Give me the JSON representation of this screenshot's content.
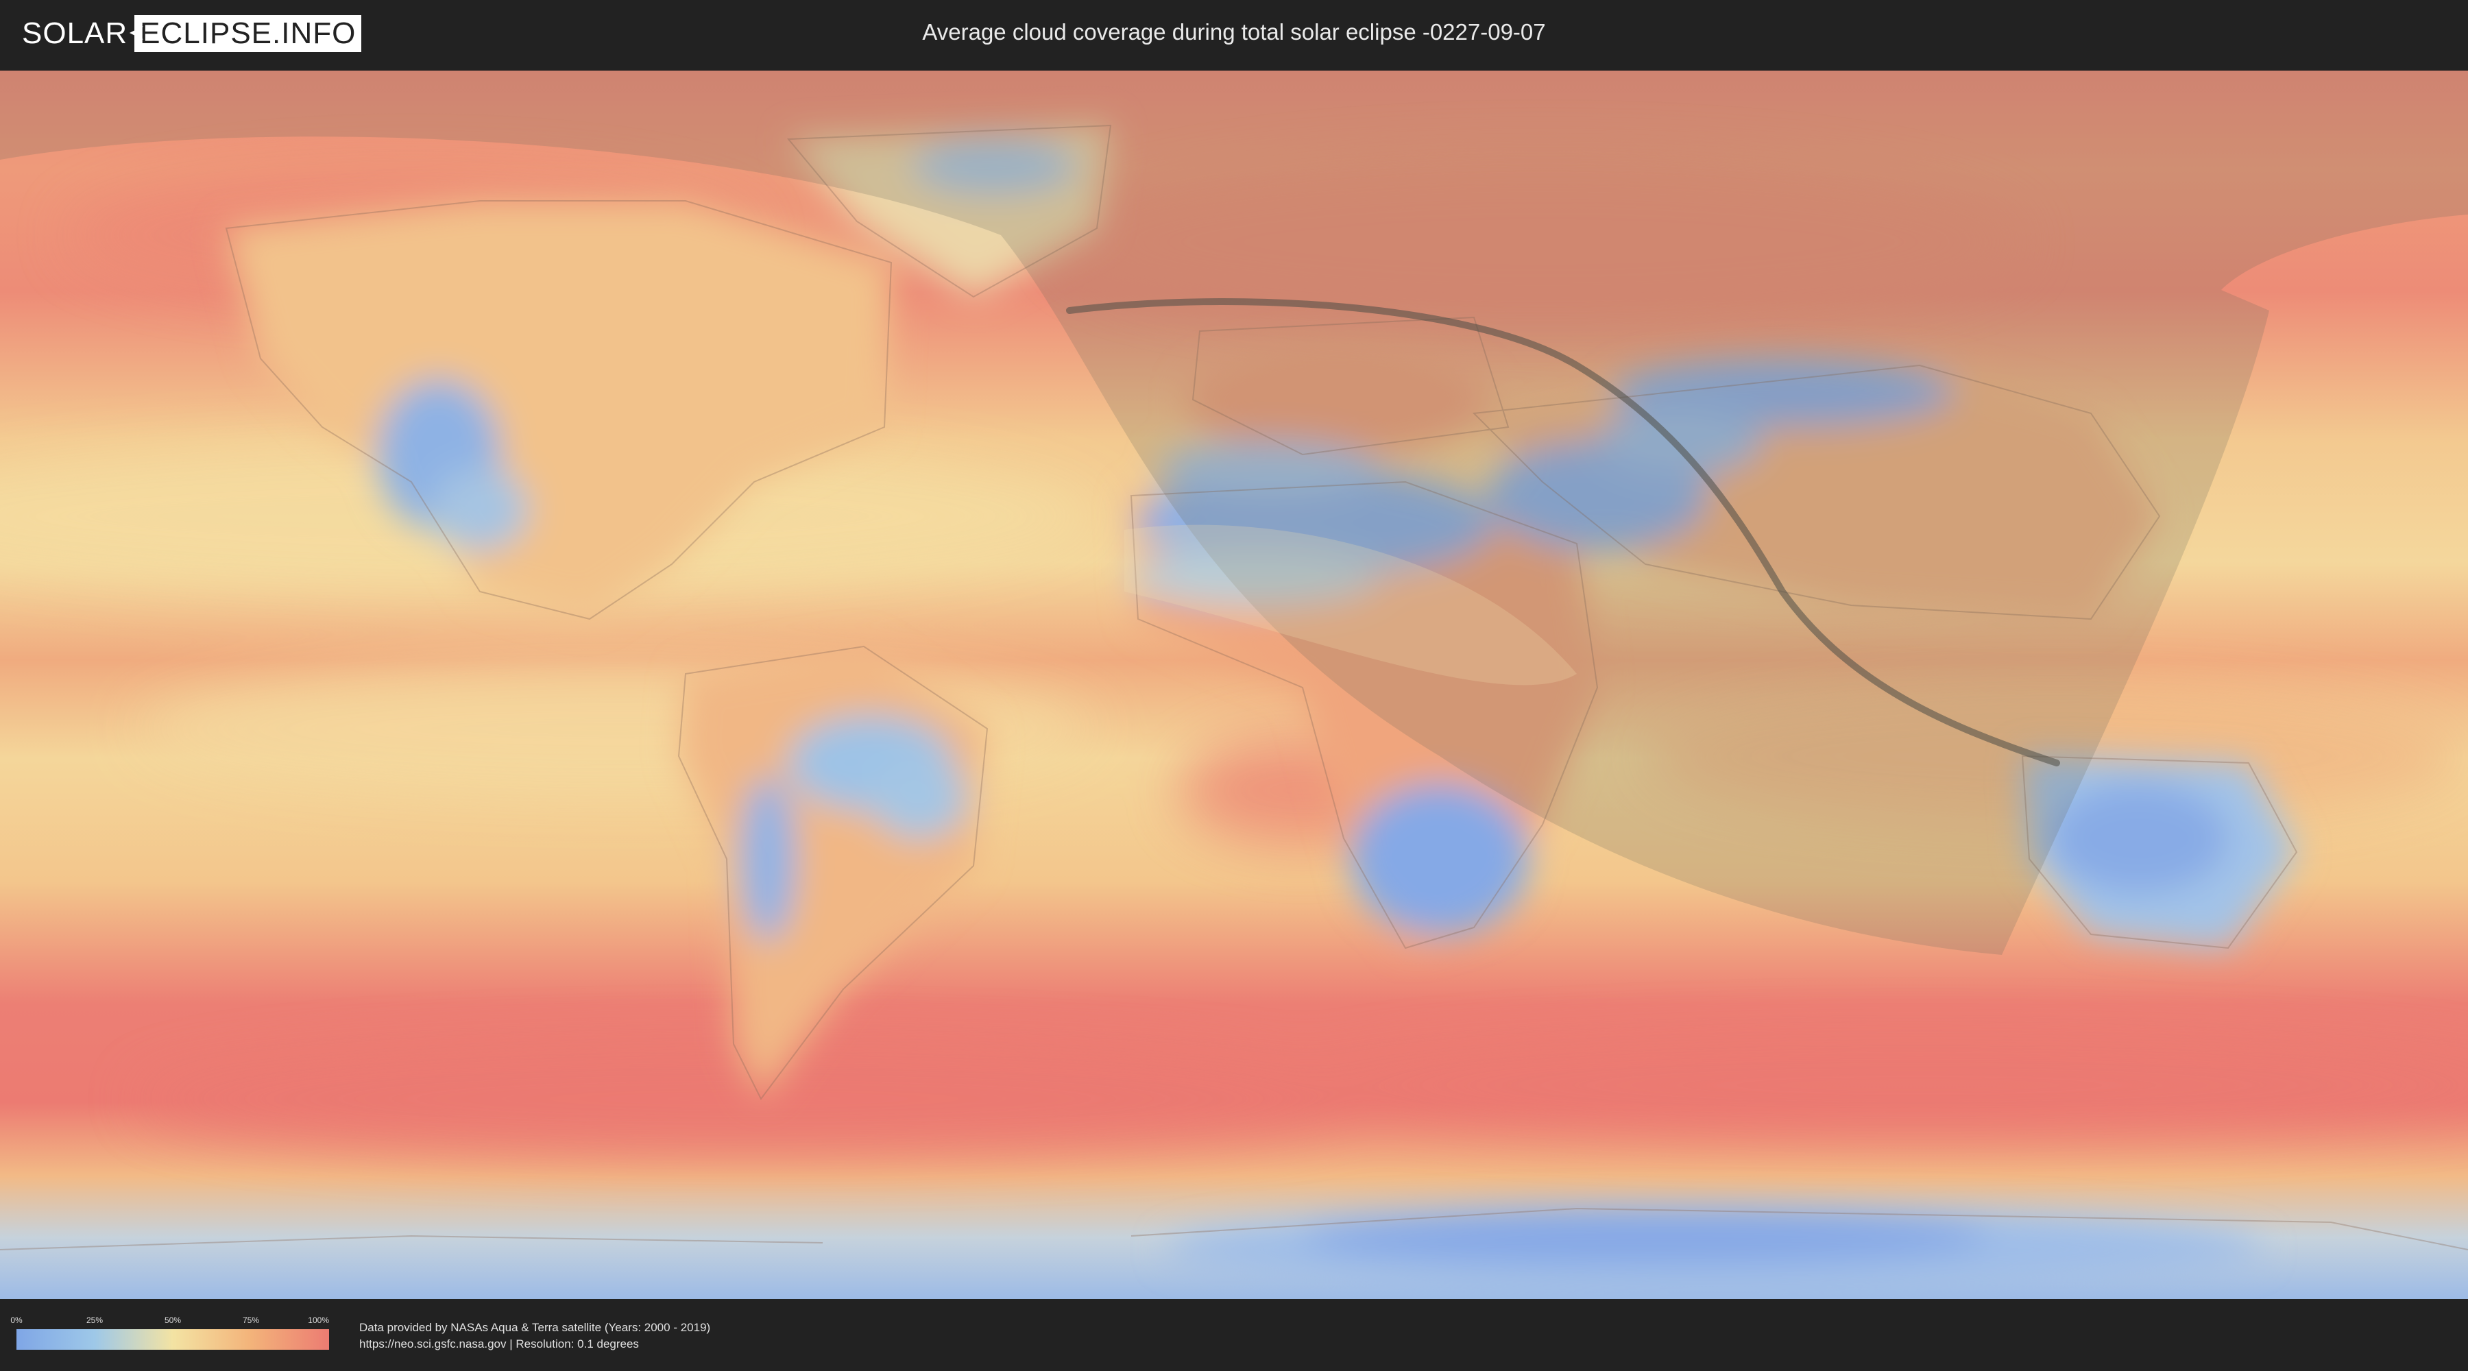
{
  "header": {
    "logo_left": "SOLAR",
    "logo_right": "ECLIPSE.INFO",
    "title": "Average cloud coverage during total solar eclipse -0227-09-07"
  },
  "legend": {
    "ticks": [
      "0%",
      "25%",
      "50%",
      "75%",
      "100%"
    ],
    "colors": [
      "#7fa6e6",
      "#9ec8e8",
      "#f3e3a3",
      "#f3b37a",
      "#ec7c72"
    ]
  },
  "credits": {
    "line1": "Data provided by NASAs Aqua & Terra satellite (Years: 2000 - 2019)",
    "line2": "https://neo.sci.gsfc.nasa.gov | Resolution: 0.1 degrees"
  },
  "map": {
    "projection": "equirectangular",
    "layer": "average cloud coverage",
    "overlay": "eclipse visibility zone and path of totality",
    "colors": {
      "clear": "#7fa6e6",
      "mid": "#f3e3a3",
      "cloudy": "#ec7c72",
      "penumbra_shade": "#6b6b5a",
      "central_path": "#4d4d45"
    }
  }
}
